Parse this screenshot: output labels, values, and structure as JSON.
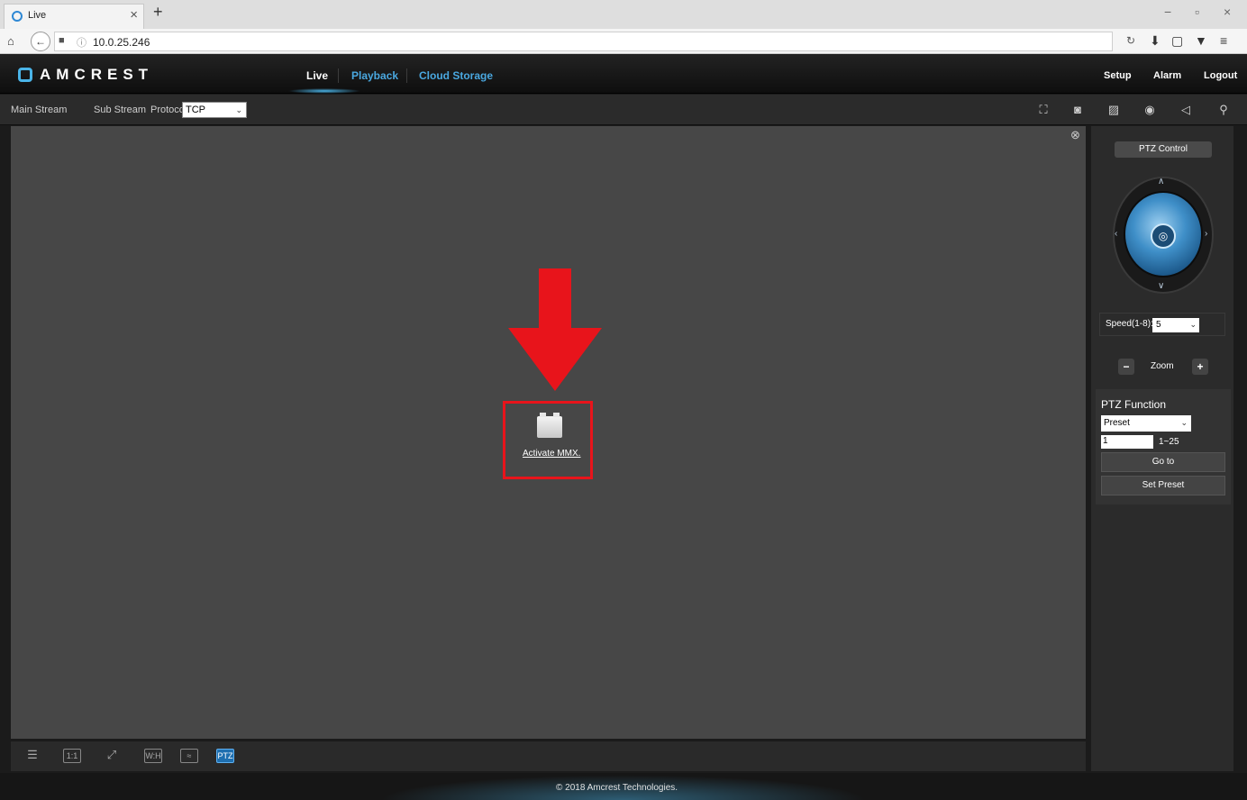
{
  "browser": {
    "tab_title": "Live",
    "tab_close": "×",
    "new_tab": "+",
    "url": "10.0.25.246",
    "window_controls": [
      "−",
      "▫",
      "×"
    ]
  },
  "app": {
    "logo": "AMCREST",
    "nav": {
      "live": "Live",
      "playback": "Playback",
      "cloud": "Cloud Storage"
    },
    "right_nav": {
      "setup": "Setup",
      "alarm": "Alarm",
      "logout": "Logout"
    },
    "accent_color": "#4aa8e0"
  },
  "toolbar": {
    "main_stream": "Main Stream",
    "sub_stream": "Sub Stream",
    "protocol_label": "Protocol",
    "protocol_value": "TCP",
    "icons": [
      "region-zoom-icon",
      "snapshot-icon",
      "image-icon",
      "record-icon",
      "mute-icon",
      "microphone-icon"
    ]
  },
  "video": {
    "plugin_link": "Activate MMX.",
    "highlight_color": "#e8141b"
  },
  "bottom_bar": {
    "ratio_label": "1:1",
    "wh_label": "W:H",
    "ptz_label": "PTZ"
  },
  "ptz": {
    "title": "PTZ Control",
    "speed_label": "Speed(1-8):",
    "speed_value": "5",
    "zoom_label": "Zoom",
    "function_title": "PTZ Function",
    "function_value": "Preset",
    "preset_value": "1",
    "preset_range": "1~25",
    "goto_label": "Go to",
    "set_preset_label": "Set Preset"
  },
  "footer": {
    "copyright": "© 2018 Amcrest Technologies."
  }
}
